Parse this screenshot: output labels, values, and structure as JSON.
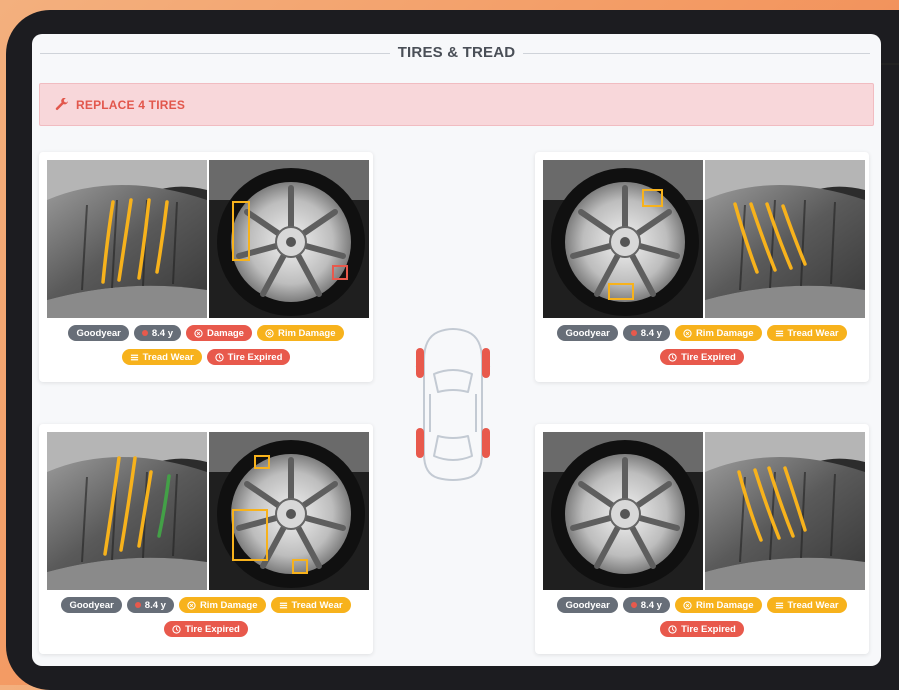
{
  "section": {
    "title": "TIRES & TREAD"
  },
  "alert": {
    "icon": "wrench-icon",
    "text": "REPLACE 4 TIRES",
    "color": "#e2574c"
  },
  "colors": {
    "gray_chip": "#676e78",
    "red_chip": "#e8594c",
    "yellow_chip": "#f7b21c",
    "alert_bg": "#f8d7da"
  },
  "tires": {
    "front_left": {
      "brand": "Goodyear",
      "age": "8.4 y",
      "row1": [
        {
          "label": "Damage",
          "type": "red",
          "icon": "circle-x-icon"
        },
        {
          "label": "Rim Damage",
          "type": "yellow",
          "icon": "circle-x-icon"
        }
      ],
      "row2": [
        {
          "label": "Tread Wear",
          "type": "yellow",
          "icon": "lines-icon"
        },
        {
          "label": "Tire Expired",
          "type": "red",
          "icon": "clock-icon"
        }
      ]
    },
    "front_right": {
      "brand": "Goodyear",
      "age": "8.4 y",
      "row1": [
        {
          "label": "Rim Damage",
          "type": "yellow",
          "icon": "circle-x-icon"
        },
        {
          "label": "Tread Wear",
          "type": "yellow",
          "icon": "lines-icon"
        }
      ],
      "row2": [
        {
          "label": "Tire Expired",
          "type": "red",
          "icon": "clock-icon"
        }
      ]
    },
    "rear_left": {
      "brand": "Goodyear",
      "age": "8.4 y",
      "row1": [
        {
          "label": "Rim Damage",
          "type": "yellow",
          "icon": "circle-x-icon"
        },
        {
          "label": "Tread Wear",
          "type": "yellow",
          "icon": "lines-icon"
        }
      ],
      "row2": [
        {
          "label": "Tire Expired",
          "type": "red",
          "icon": "clock-icon"
        }
      ]
    },
    "rear_right": {
      "brand": "Goodyear",
      "age": "8.4 y",
      "row1": [
        {
          "label": "Rim Damage",
          "type": "yellow",
          "icon": "circle-x-icon"
        },
        {
          "label": "Tread Wear",
          "type": "yellow",
          "icon": "lines-icon"
        }
      ],
      "row2": [
        {
          "label": "Tire Expired",
          "type": "red",
          "icon": "clock-icon"
        }
      ]
    }
  }
}
